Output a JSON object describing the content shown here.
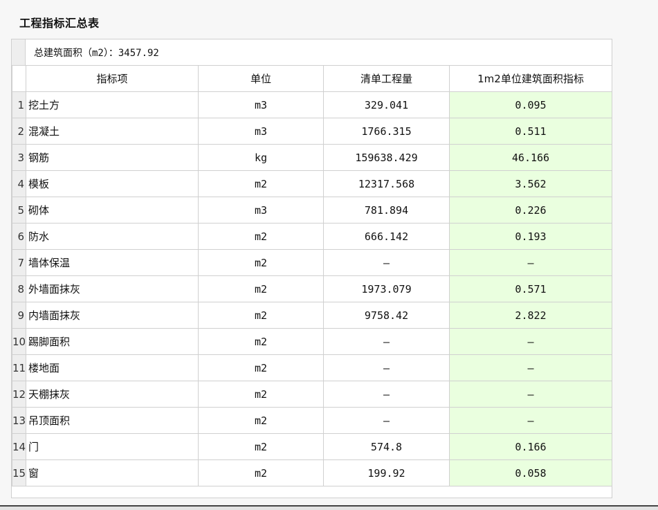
{
  "panel": {
    "title": "工程指标汇总表"
  },
  "summary": {
    "area_text": "总建筑面积（m2）：3457.92"
  },
  "table": {
    "headers": [
      "指标项",
      "单位",
      "清单工程量",
      "1m2单位建筑面积指标"
    ],
    "rows": [
      {
        "no": "1",
        "name": "挖土方",
        "unit": "m3",
        "qty": "329.041",
        "index": "0.095"
      },
      {
        "no": "2",
        "name": "混凝土",
        "unit": "m3",
        "qty": "1766.315",
        "index": "0.511"
      },
      {
        "no": "3",
        "name": "钢筋",
        "unit": "kg",
        "qty": "159638.429",
        "index": "46.166"
      },
      {
        "no": "4",
        "name": "模板",
        "unit": "m2",
        "qty": "12317.568",
        "index": "3.562"
      },
      {
        "no": "5",
        "name": "砌体",
        "unit": "m3",
        "qty": "781.894",
        "index": "0.226"
      },
      {
        "no": "6",
        "name": "防水",
        "unit": "m2",
        "qty": "666.142",
        "index": "0.193"
      },
      {
        "no": "7",
        "name": "墙体保温",
        "unit": "m2",
        "qty": "—",
        "index": "—"
      },
      {
        "no": "8",
        "name": "外墙面抹灰",
        "unit": "m2",
        "qty": "1973.079",
        "index": "0.571"
      },
      {
        "no": "9",
        "name": "内墙面抹灰",
        "unit": "m2",
        "qty": "9758.42",
        "index": "2.822"
      },
      {
        "no": "10",
        "name": "踢脚面积",
        "unit": "m2",
        "qty": "—",
        "index": "—"
      },
      {
        "no": "11",
        "name": "楼地面",
        "unit": "m2",
        "qty": "—",
        "index": "—"
      },
      {
        "no": "12",
        "name": "天棚抹灰",
        "unit": "m2",
        "qty": "—",
        "index": "—"
      },
      {
        "no": "13",
        "name": "吊顶面积",
        "unit": "m2",
        "qty": "—",
        "index": "—"
      },
      {
        "no": "14",
        "name": "门",
        "unit": "m2",
        "qty": "574.8",
        "index": "0.166"
      },
      {
        "no": "15",
        "name": "窗",
        "unit": "m2",
        "qty": "199.92",
        "index": "0.058"
      }
    ]
  },
  "colors": {
    "index_column_bg": "#eaffdf",
    "row_header_bg": "#eeeeee",
    "grid_line": "#d0d0d0"
  }
}
